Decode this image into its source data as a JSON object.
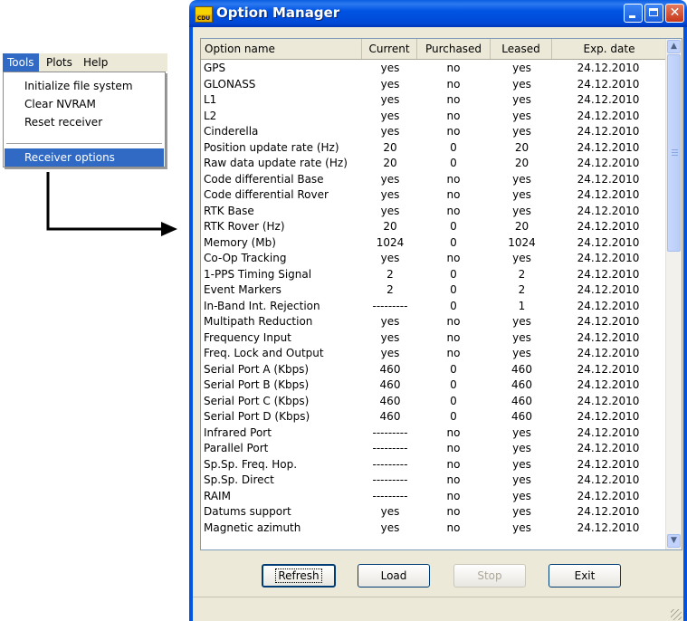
{
  "menu": {
    "bar": [
      "Tools",
      "Plots",
      "Help"
    ],
    "items": [
      "Initialize file system",
      "Clear NVRAM",
      "Reset receiver",
      "Receiver options"
    ]
  },
  "window": {
    "title": "Option Manager",
    "icon_text": "CDU"
  },
  "grid": {
    "headers": [
      "Option name",
      "Current",
      "Purchased",
      "Leased",
      "Exp. date"
    ],
    "rows": [
      [
        "GPS",
        "yes",
        "no",
        "yes",
        "24.12.2010"
      ],
      [
        "GLONASS",
        "yes",
        "no",
        "yes",
        "24.12.2010"
      ],
      [
        "L1",
        "yes",
        "no",
        "yes",
        "24.12.2010"
      ],
      [
        "L2",
        "yes",
        "no",
        "yes",
        "24.12.2010"
      ],
      [
        "Cinderella",
        "yes",
        "no",
        "yes",
        "24.12.2010"
      ],
      [
        "Position update rate (Hz)",
        "20",
        "0",
        "20",
        "24.12.2010"
      ],
      [
        "Raw data update rate (Hz)",
        "20",
        "0",
        "20",
        "24.12.2010"
      ],
      [
        "Code differential Base",
        "yes",
        "no",
        "yes",
        "24.12.2010"
      ],
      [
        "Code differential Rover",
        "yes",
        "no",
        "yes",
        "24.12.2010"
      ],
      [
        "RTK Base",
        "yes",
        "no",
        "yes",
        "24.12.2010"
      ],
      [
        "RTK Rover (Hz)",
        "20",
        "0",
        "20",
        "24.12.2010"
      ],
      [
        "Memory (Mb)",
        "1024",
        "0",
        "1024",
        "24.12.2010"
      ],
      [
        "Co-Op Tracking",
        "yes",
        "no",
        "yes",
        "24.12.2010"
      ],
      [
        "1-PPS Timing Signal",
        "2",
        "0",
        "2",
        "24.12.2010"
      ],
      [
        "Event Markers",
        "2",
        "0",
        "2",
        "24.12.2010"
      ],
      [
        "In-Band Int. Rejection",
        "---------",
        "0",
        "1",
        "24.12.2010"
      ],
      [
        "Multipath Reduction",
        "yes",
        "no",
        "yes",
        "24.12.2010"
      ],
      [
        "Frequency Input",
        "yes",
        "no",
        "yes",
        "24.12.2010"
      ],
      [
        "Freq. Lock and Output",
        "yes",
        "no",
        "yes",
        "24.12.2010"
      ],
      [
        "Serial Port A (Kbps)",
        "460",
        "0",
        "460",
        "24.12.2010"
      ],
      [
        "Serial Port B (Kbps)",
        "460",
        "0",
        "460",
        "24.12.2010"
      ],
      [
        "Serial Port C (Kbps)",
        "460",
        "0",
        "460",
        "24.12.2010"
      ],
      [
        "Serial Port D (Kbps)",
        "460",
        "0",
        "460",
        "24.12.2010"
      ],
      [
        "Infrared Port",
        "---------",
        "no",
        "yes",
        "24.12.2010"
      ],
      [
        "Parallel Port",
        "---------",
        "no",
        "yes",
        "24.12.2010"
      ],
      [
        "Sp.Sp. Freq. Hop.",
        "---------",
        "no",
        "yes",
        "24.12.2010"
      ],
      [
        "Sp.Sp. Direct",
        "---------",
        "no",
        "yes",
        "24.12.2010"
      ],
      [
        "RAIM",
        "---------",
        "no",
        "yes",
        "24.12.2010"
      ],
      [
        "Datums support",
        "yes",
        "no",
        "yes",
        "24.12.2010"
      ],
      [
        "Magnetic azimuth",
        "yes",
        "no",
        "yes",
        "24.12.2010"
      ]
    ]
  },
  "buttons": {
    "refresh": "Refresh",
    "load": "Load",
    "stop": "Stop",
    "exit": "Exit"
  },
  "colors": {
    "title_bar": "#0054e3",
    "selection": "#316ac5",
    "close_button": "#c7371a"
  }
}
